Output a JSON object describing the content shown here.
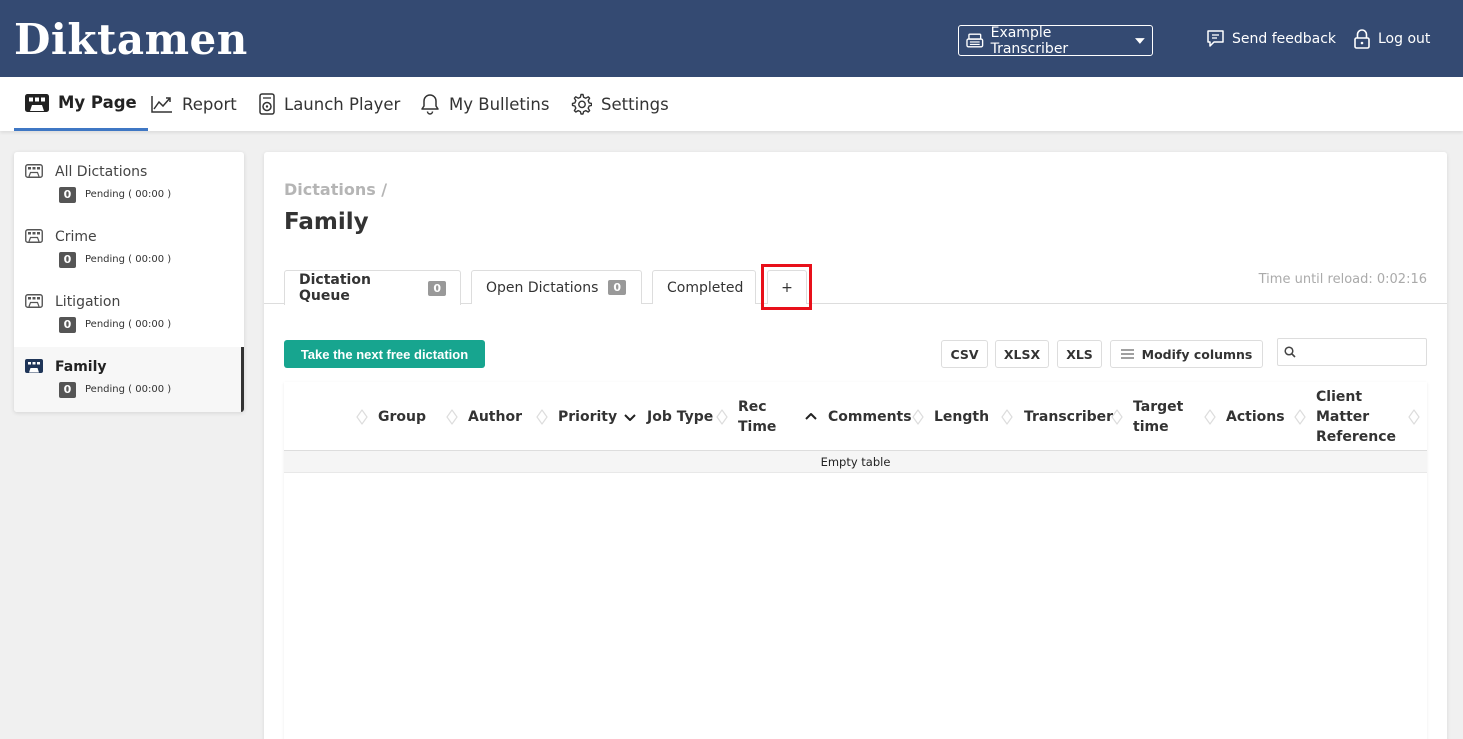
{
  "app": {
    "logo": "Diktamen"
  },
  "header": {
    "user_label": "Example Transcriber",
    "feedback_label": "Send feedback",
    "logout_label": "Log out"
  },
  "nav": {
    "my_page": "My Page",
    "report": "Report",
    "launch_player": "Launch Player",
    "my_bulletins": "My Bulletins",
    "settings": "Settings"
  },
  "sidebar": {
    "items": [
      {
        "name": "All Dictations",
        "count": "0",
        "pending": "Pending ( 00:00 )"
      },
      {
        "name": "Crime",
        "count": "0",
        "pending": "Pending ( 00:00 )"
      },
      {
        "name": "Litigation",
        "count": "0",
        "pending": "Pending ( 00:00 )"
      },
      {
        "name": "Family",
        "count": "0",
        "pending": "Pending ( 00:00 )"
      }
    ]
  },
  "main": {
    "breadcrumb": "Dictations /",
    "title": "Family",
    "reload": "Time until reload: 0:02:16",
    "tabs": [
      {
        "label": "Dictation Queue",
        "count": "0"
      },
      {
        "label": "Open Dictations",
        "count": "0"
      },
      {
        "label": "Completed"
      },
      {
        "label": "+"
      }
    ],
    "take_next": "Take the next free dictation",
    "export": {
      "csv": "CSV",
      "xlsx": "XLSX",
      "xls": "XLS"
    },
    "modify_columns": "Modify columns",
    "search_placeholder": ""
  },
  "table": {
    "columns": [
      {
        "label": "Group",
        "sort": "none"
      },
      {
        "label": "Author",
        "sort": "none"
      },
      {
        "label": "Priority",
        "sort": "none"
      },
      {
        "label": "Job Type",
        "sort": "desc"
      },
      {
        "label": "Rec Time",
        "sort": "none"
      },
      {
        "label": "Comments",
        "sort": "asc"
      },
      {
        "label": "Length",
        "sort": "none"
      },
      {
        "label": "Transcriber",
        "sort": "none"
      },
      {
        "label": "Target time",
        "sort": "none"
      },
      {
        "label": "Actions",
        "sort": "none"
      },
      {
        "label": "Client Matter Reference",
        "sort": "none"
      }
    ],
    "empty_text": "Empty table"
  },
  "colors": {
    "header_bg": "#344a72",
    "accent_green": "#17a58f",
    "active_nav_underline": "#3f77c4",
    "highlight_red": "#e8101a"
  }
}
